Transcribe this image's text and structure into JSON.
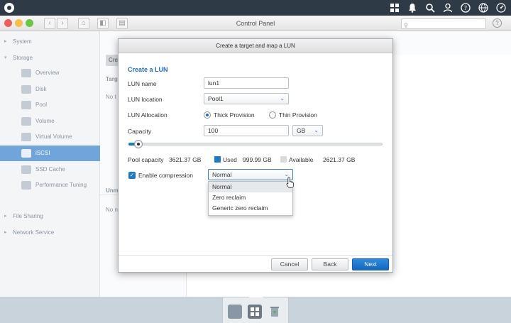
{
  "system_bar": {
    "icons": [
      "logo-icon",
      "apps-grid-icon",
      "bell-icon",
      "search-icon",
      "user-icon",
      "help-icon",
      "globe-icon",
      "dashboard-icon"
    ]
  },
  "window": {
    "title": "Control Panel",
    "search_placeholder": "",
    "help_label": "?"
  },
  "sidebar": {
    "groups": [
      "System",
      "Storage",
      "File Sharing",
      "Network Service"
    ],
    "storage_items": [
      "Overview",
      "Disk",
      "Pool",
      "Volume",
      "Virtual Volume",
      "iSCSI",
      "SSD Cache",
      "Performance Tuning"
    ],
    "active_item": "iSCSI"
  },
  "main": {
    "partial_button": "Cre",
    "partial_section1": "Targ",
    "partial_empty1": "No t",
    "partial_section2": "Unm",
    "partial_empty2": "No n"
  },
  "dialog": {
    "title": "Create a target and map a LUN",
    "heading": "Create a LUN",
    "lun_name_label": "LUN name",
    "lun_name_value": "lun1",
    "lun_location_label": "LUN location",
    "lun_location_value": "Pool1",
    "lun_allocation_label": "LUN Allocation",
    "thick_label": "Thick Provision",
    "thin_label": "Thin Provision",
    "allocation_selected": "Thick Provision",
    "capacity_label": "Capacity",
    "capacity_value": "100",
    "capacity_unit": "GB",
    "capacity_slider_fraction": 0.04,
    "pool_capacity_label": "Pool capacity",
    "pool_capacity_value": "3621.37 GB",
    "used_label": "Used",
    "used_value": "999.99 GB",
    "available_label": "Available",
    "available_value": "2621.37 GB",
    "used_color": "#1a7acb",
    "available_color": "#d9dcdf",
    "compression_label": "Enable compression",
    "compression_checked": true,
    "compression_value": "Normal",
    "compression_options": [
      "Normal",
      "Zero reclaim",
      "Generic zero reclaim"
    ],
    "buttons": {
      "cancel": "Cancel",
      "back": "Back",
      "next": "Next"
    }
  }
}
